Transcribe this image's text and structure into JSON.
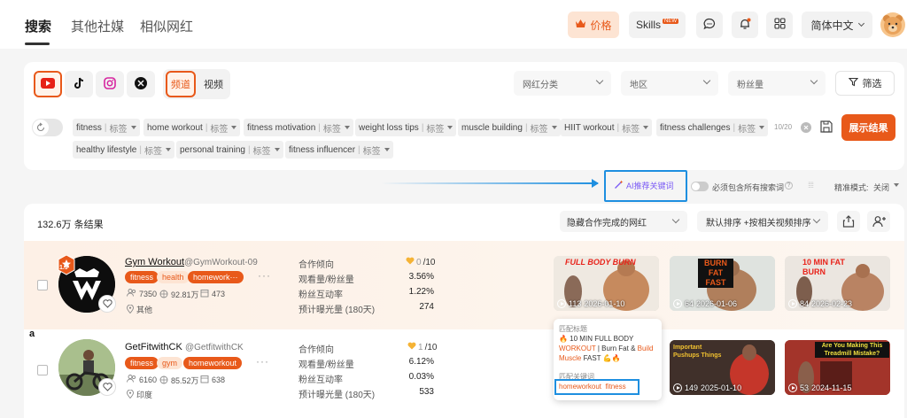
{
  "nav": {
    "tabs": [
      "搜索",
      "其他社媒",
      "相似网红"
    ],
    "price_label": "价格",
    "skills_label": "Skills",
    "new_badge": "NEW",
    "language_label": "简体中文"
  },
  "filters": {
    "platforms": [
      "youtube-icon",
      "tiktok-icon",
      "instagram-icon",
      "x-icon"
    ],
    "mode_channel": "频道",
    "mode_video": "视频",
    "category_placeholder": "网红分类",
    "region_placeholder": "地区",
    "followers_placeholder": "粉丝量",
    "filter_label": "筛选",
    "keywords_row1": [
      "fitness",
      "home workout",
      "fitness motivation",
      "weight loss tips",
      "muscle building",
      "HIIT workout",
      "fitness challenges"
    ],
    "keywords_row2": [
      "healthy lifestyle",
      "personal training",
      "fitness influencer"
    ],
    "tag_label": "标签",
    "keyword_count": "10/20",
    "show_results_label": "展示结果",
    "ai_recommend_label": "AI推荐关键词",
    "must_include_label": "必须包含所有搜索词",
    "precise_mode_label": "精准模式:",
    "precise_mode_value": "关闭"
  },
  "results": {
    "count_label": "132.6万 条结果",
    "hide_completed_label": "隐藏合作完成的网红",
    "sort_label": "默认排序 +按相关视频排序",
    "stat_labels": [
      "合作倾向",
      "观看量/粉丝量",
      "粉丝互动率",
      "预计曝光量 (180天)"
    ],
    "rows": [
      {
        "name": "Gym Workout",
        "handle": "@GymWorkout-09",
        "tags": [
          "fitness",
          "health",
          "homework···"
        ],
        "videos_count": "7350",
        "followers": "92.81万",
        "uploads": "473",
        "location": "其他",
        "coop": "0",
        "coop_max": "/10",
        "view_ratio": "3.56%",
        "engagement": "1.22%",
        "exposure": "274",
        "avatar_badge": "1.9",
        "thumbs": [
          {
            "views": "113",
            "date": "2026-01-10",
            "title": "FULL BODY BURN"
          },
          {
            "views": "64",
            "date": "2026-01-06",
            "title": "BURN FAT FAST"
          },
          {
            "views": "84",
            "date": "2026-02-23",
            "title": "10 MIN FAT BURN"
          }
        ]
      },
      {
        "name": "GetFitwithCK",
        "handle": "@GetfitwithCK",
        "tags": [
          "fitness",
          "gym",
          "homeworkout"
        ],
        "videos_count": "6160",
        "followers": "85.52万",
        "uploads": "638",
        "location": "印度",
        "coop": "1",
        "coop_max": "/10",
        "view_ratio": "6.12%",
        "engagement": "0.03%",
        "exposure": "533",
        "thumbs": [
          {
            "views": "",
            "date": "",
            "title": ""
          },
          {
            "views": "149",
            "date": "2025-01-10",
            "title": "Important Pushups Things"
          },
          {
            "views": "53",
            "date": "2024-11-15",
            "title": "Are You Making This Treadmill Mistake?"
          }
        ]
      }
    ],
    "tooltip": {
      "title_label": "匹配标题",
      "title_prefix": "🔥 10 MIN FULL BODY ",
      "title_hl1": "WORKOUT",
      "title_mid": " | Burn Fat & ",
      "title_hl2": "Build Muscle",
      "title_suffix": " FAST 💪🔥",
      "kw_label": "匹配关键词",
      "kw_value": "homeworkout  fitness"
    }
  },
  "colors": {
    "accent": "#e8591a",
    "accent_light": "#fde4d3",
    "highlight_blue": "#1e8fe0"
  }
}
